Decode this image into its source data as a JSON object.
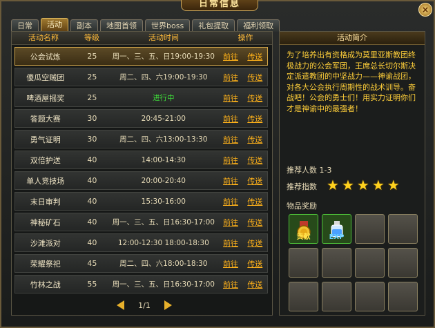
{
  "window": {
    "title": "日常信息",
    "close_symbol": "×"
  },
  "tabs": [
    "日常",
    "活动",
    "副本",
    "地图首领",
    "世界boss",
    "礼包提取",
    "福利领取"
  ],
  "active_tab": 1,
  "table": {
    "headers": {
      "name": "活动名称",
      "level": "等级",
      "time": "活动时间",
      "ops": "操作"
    },
    "rows": [
      {
        "name": "公会试炼",
        "level": "25",
        "time": "周一、三、五、日19:00-19:30",
        "go": "前往",
        "send": "传送"
      },
      {
        "name": "傻瓜空贼团",
        "level": "25",
        "time": "周二、四、六19:00-19:30",
        "go": "前往",
        "send": "传送"
      },
      {
        "name": "啤酒屋摇奖",
        "level": "25",
        "time": "进行中",
        "go": "前往",
        "send": "传送"
      },
      {
        "name": "答题大赛",
        "level": "30",
        "time": "20:45-21:00",
        "go": "前往",
        "send": "传送"
      },
      {
        "name": "勇气证明",
        "level": "30",
        "time": "周二、四、六13:00-13:30",
        "go": "前往",
        "send": "传送"
      },
      {
        "name": "双倍护送",
        "level": "40",
        "time": "14:00-14:30",
        "go": "前往",
        "send": "传送"
      },
      {
        "name": "单人竞技场",
        "level": "40",
        "time": "20:00-20:40",
        "go": "前往",
        "send": "传送"
      },
      {
        "name": "末日审判",
        "level": "40",
        "time": "15:30-16:00",
        "go": "前往",
        "send": "传送"
      },
      {
        "name": "神秘矿石",
        "level": "40",
        "time": "周一、三、五、日16:30-17:00",
        "go": "前往",
        "send": "传送"
      },
      {
        "name": "沙滩派对",
        "level": "40",
        "time": "12:00-12:30 18:00-18:30",
        "go": "前往",
        "send": "传送"
      },
      {
        "name": "荣耀祭祀",
        "level": "45",
        "time": "周二、四、六18:00-18:30",
        "go": "前往",
        "send": "传送"
      },
      {
        "name": "竹林之战",
        "level": "55",
        "time": "周一、三、五、日16:30-17:00",
        "go": "前往",
        "send": "传送"
      }
    ],
    "selected_row": 0,
    "ongoing_color": "#3fdc3a"
  },
  "pager": {
    "text": "1/1"
  },
  "detail": {
    "title": "活动简介",
    "description": "为了培养出有资格成为莫里亚斯教团终极战力的公会军团，王席总长切尔斯决定派遣教团的中坚战力——神谕战团，对各大公会执行周期性的战术训导。奋战吧！公会的勇士们！用实力证明你们才是神谕中的最强者！",
    "players_label": "推荐人数 1-3",
    "rating_label": "推荐指数",
    "rating": 5,
    "rewards_label": "物品奖励",
    "rewards": [
      {
        "tag": "贡献",
        "icon": "contribution-medal-icon"
      },
      {
        "tag": "EXP",
        "icon": "exp-potion-icon"
      }
    ],
    "reward_slots": 12
  }
}
